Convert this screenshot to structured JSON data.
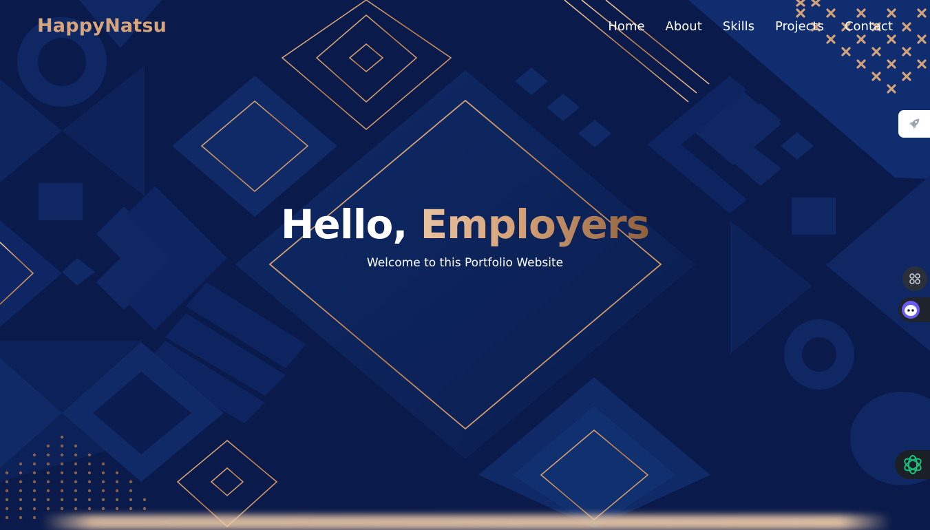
{
  "brand": {
    "name": "HappyNatsu"
  },
  "nav": {
    "items": [
      "Home",
      "About",
      "Skills",
      "Projects",
      "Contact"
    ]
  },
  "hero": {
    "greeting": "Hello,",
    "audience": "Employers",
    "subtitle": "Welcome to this Portfolio Website"
  },
  "side_widgets": {
    "icons": [
      "rocket-icon",
      "apps-grid-icon",
      "assistant-face-icon",
      "openai-icon"
    ]
  },
  "colors": {
    "background": "#0a1a4a",
    "panel": "#0d2255",
    "gold": "#d6a57c",
    "text": "#ffffff"
  }
}
